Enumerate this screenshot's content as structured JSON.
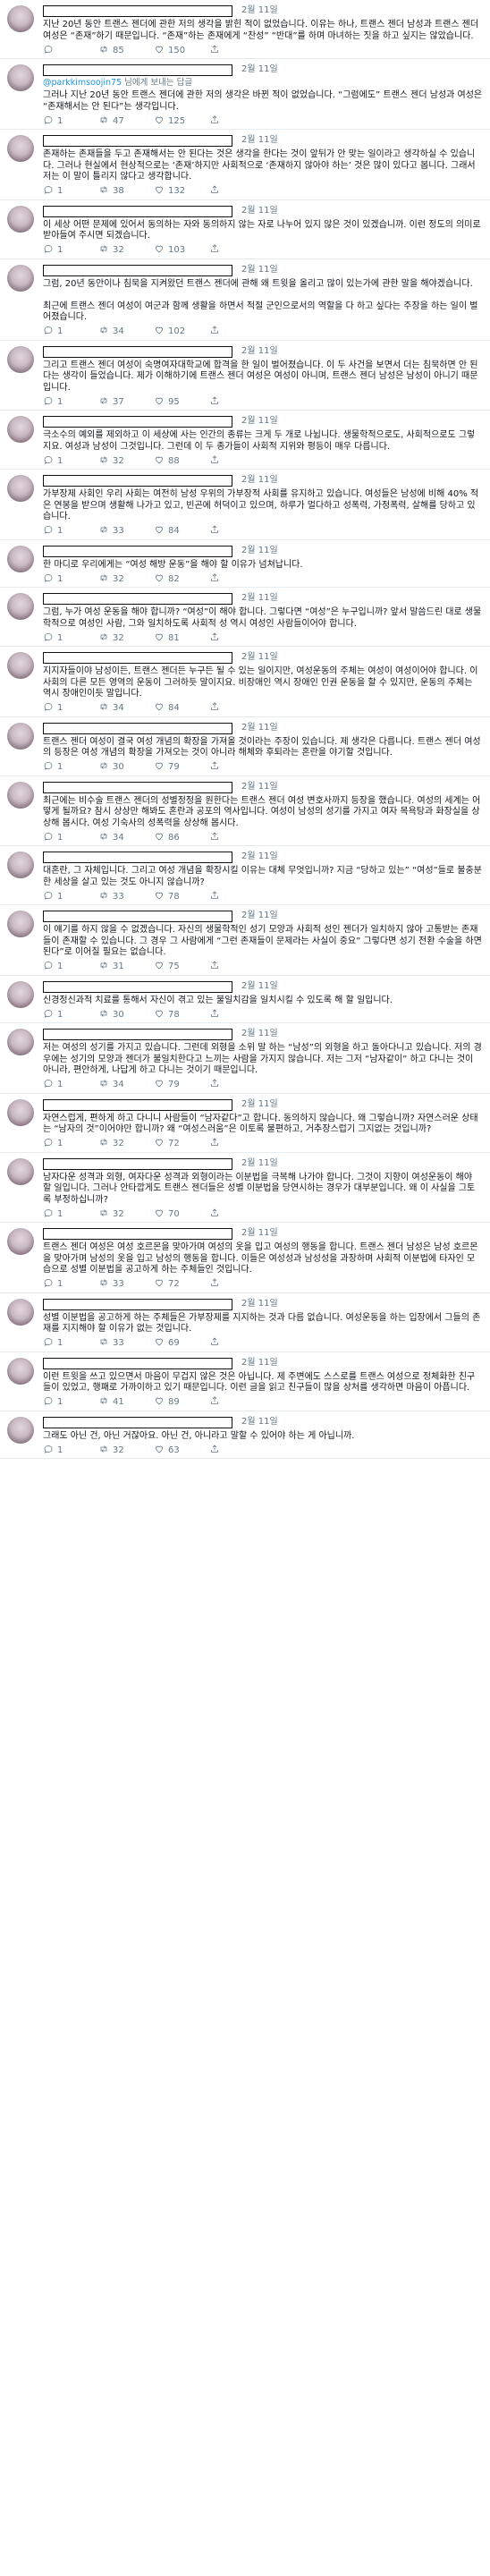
{
  "tweets": [
    {
      "date": "2월 11일",
      "body": "지난 20년 동안 트랜스 젠더에 관한 저의 생각을 밝힌 적이 없었습니다. 이유는 하나, 트랜스 젠더 남성과 트랜스 젠더 여성은 “존재”하기 때문입니다. “존재”하는 존재에게 “찬성” “반대”를 하며 마녀하는 짓을 하고 싶지는 않았습니다.",
      "counts": {
        "reply": "",
        "retweet": "85",
        "like": "150"
      }
    },
    {
      "date": "2월 11일",
      "reply_label": "님에게 보내는 답글",
      "reply_handle": "@parkkimsoojin75",
      "body": "그러나 지난 20년 동안 트랜스 젠더에 관한 저의 생각은 바뀐 적이 없었습니다. “그럼에도” 트랜스 젠더 남성과 여성은 “존재해서는 안 된다”는 생각입니다.",
      "counts": {
        "reply": "1",
        "retweet": "47",
        "like": "125"
      }
    },
    {
      "date": "2월 11일",
      "body": "존재하는 존재들을 두고 존재해서는 안 된다는 것은 생각을 한다는 것이 앞뒤가 안 맞는 일이라고 생각하실 수 있습니다. 그러나 현실에서 현상적으로는 ‘존재’하지만 사회적으로 ‘존재하지 않아야 하는’ 것은 많이 있다고 봅니다. 그래서 저는 이 말이 틀리지 않다고 생각합니다.",
      "counts": {
        "reply": "1",
        "retweet": "38",
        "like": "132"
      }
    },
    {
      "date": "2월 11일",
      "body": "이 세상 어떤 문제에 있어서 동의하는 자와 동의하지 않는 자로 나누어 있지 않은 것이 있겠습니까. 이런 정도의 의미로 받아들여 주시면 되겠습니다.",
      "counts": {
        "reply": "1",
        "retweet": "32",
        "like": "103"
      }
    },
    {
      "date": "2월 11일",
      "body": "그럼, 20년 동안이나 침묵을 지켜왔던 트랜스 젠더에 관해 왜 트윗을 올리고 많이 있는가에 관한 말을 해야겠습니다.\n\n최근에 트랜스 젠더 여성이 여군과 함께 생활을 하면서 적절 군인으로서의 역할을 다 하고 싶다는 주장을 하는 일이 벌어졌습니다.",
      "counts": {
        "reply": "1",
        "retweet": "34",
        "like": "102"
      }
    },
    {
      "date": "2월 11일",
      "body": "그리고 트랜스 젠더 여성이 숙명여자대학교에 합격을 한 일이 벌어졌습니다. 이 두 사건을 보면서 더는 침묵하면 안 된다는 생각이 들었습니다. 제가 이해하기에 트랜스 젠더 여성은 여성이 아니며, 트랜스 젠더 남성은 남성이 아니기 때문입니다.",
      "counts": {
        "reply": "1",
        "retweet": "37",
        "like": "95"
      }
    },
    {
      "date": "2월 11일",
      "body": "극소수의 예외를 제외하고 이 세상에 사는 인간의 종류는 크게 두 개로 나뉩니다. 생물학적으로도, 사회적으로도 그렇지요. 여성과 남성이 그것입니다. 그런데 이 두 종가들이 사회적 지위와 평등이 매우 다릅니다.",
      "counts": {
        "reply": "1",
        "retweet": "32",
        "like": "88"
      }
    },
    {
      "date": "2월 11일",
      "body": "가부장제 사회인 우리 사회는 여전히 남성 우위의 가부장적 사회를 유지하고 있습니다. 여성들은 남성에 비해 40% 적은 연봉을 받으며 생활해 나가고 있고, 빈곤에 허덕이고 있으며, 하루가 멀다하고 성폭력, 가정폭력, 살해를 당하고 있습니다.",
      "counts": {
        "reply": "1",
        "retweet": "33",
        "like": "84"
      }
    },
    {
      "date": "2월 11일",
      "body": "한 마디로 우리에게는 “여성 해방 운동”을 해야 할 이유가 넘쳐납니다.",
      "counts": {
        "reply": "1",
        "retweet": "32",
        "like": "82"
      }
    },
    {
      "date": "2월 11일",
      "body": "그럼, 누가 여성 운동을 해야 합니까? “여성”이 해야 합니다. 그렇다면 “여성”은 누구입니까? 앞서 말씀드린 대로 생물학적으로 여성인 사람, 그와 일치하도록 사회적 성 역시 여성인 사람들이어야 합니다.",
      "counts": {
        "reply": "1",
        "retweet": "32",
        "like": "81"
      }
    },
    {
      "date": "2월 11일",
      "body": "지지자들이야 남성이든, 트랜스 젠더든 누구든 될 수 있는 일이지만, 여성운동의 주체는 여성이 여성이어야 합니다. 이 사회의 다른 모든 영역의 운동이 그러하듯 말이지요. 비장애인 역시 장애인 인권 운동을 할 수 있지만, 운동의 주체는 역시 장애인이듯 말입니다.",
      "counts": {
        "reply": "1",
        "retweet": "34",
        "like": "84"
      }
    },
    {
      "date": "2월 11일",
      "body": "트랜스 젠더 여성이 결국 여성 개념의 확장을 가져올 것이라는 주장이 있습니다. 제 생각은 다릅니다. 트랜스 젠더 여성의 등장은 여성 개념의 확장을 가져오는 것이 아니라 해체와 후퇴라는 혼란을 야기할 것입니다.",
      "counts": {
        "reply": "1",
        "retweet": "30",
        "like": "79"
      }
    },
    {
      "date": "2월 11일",
      "body": "최근에는 비수술 트랜스 젠더의 성별정정을 원한다는 트랜스 젠더 여성 변호사까지 등장을 했습니다. 여성의 세계는 어떻게 될까요? 참시 상상만 해봐도 혼란과 공포의 역사입니다. 여성이 남성의 성기를 가지고 여자 목욕탕과 화장실을 상상해 봅시다. 여성 기숙사의 성폭력을 상상해 봅시다.",
      "counts": {
        "reply": "1",
        "retweet": "34",
        "like": "86"
      }
    },
    {
      "date": "2월 11일",
      "body": "대혼란, 그 자체입니다. 그리고 여성 개념을 확장시킬 이유는 대체 무엇입니까? 지금 “당하고 있는” “여성”들로 불충분한 세상을 살고 있는 것도 아니지 않습니까?",
      "counts": {
        "reply": "1",
        "retweet": "33",
        "like": "78"
      }
    },
    {
      "date": "2월 11일",
      "body": "이 얘기를 하지 않을 수 없겠습니다. 자신의 생물학적인 성기 모양과 사회적 성인 젠더가 일치하지 않아 고통받는 존재들이 존재할 수 있습니다. 그 경우 그 사람에게 “그런 존재들이 문제라는 사실이 중요” 그렇다면 성기 전환 수술을 하면 된다”로 이어질 필요는 없습니다.",
      "counts": {
        "reply": "1",
        "retweet": "31",
        "like": "75"
      }
    },
    {
      "date": "2월 11일",
      "body": "신경정신과적 치료를 통해서 자신이 겪고 있는 불일치감을 일치시킬 수 있도록 해 할 일입니다.",
      "counts": {
        "reply": "1",
        "retweet": "30",
        "like": "78"
      }
    },
    {
      "date": "2월 11일",
      "body": "저는 여성의 성기를 가지고 있습니다. 그런데 외형을 소위 말 하는 “남성”의 외형을 하고 돌아다니고 있습니다. 저의 경우에는 성기의 모양과 젠더가 불일치한다고 느끼는 사람을 가지지 않습니다. 저는 그저 “남자같이” 하고 다니는 것이 아니라, 편안하게, 나답게 하고 다니는 것이기 때문입니다.",
      "counts": {
        "reply": "1",
        "retweet": "34",
        "like": "79"
      }
    },
    {
      "date": "2월 11일",
      "body": "자연스럽게, 편하게 하고 다니니 사람들이 “남자같다”고 합니다. 동의하지 않습니다. 왜 그렇습니까? 자연스러운 상태는 “남자의 것”이어야만 합니까? 왜 “여성스러움”은 이토록 불편하고, 거추장스럽기 그지없는 것입니까?",
      "counts": {
        "reply": "1",
        "retweet": "32",
        "like": "72"
      }
    },
    {
      "date": "2월 11일",
      "body": "남자다운 성격과 외형, 여자다운 성격과 외형이라는 이분법을 극복해 나가야 합니다. 그것이 지향이 여성운동이 해야 할 일입니다. 그러나 안타깝게도 트랜스 젠더들은 성별 이분법을 당연시하는 경우가 대부분입니다. 왜 이 사실을 그토록 부정하십니까?",
      "counts": {
        "reply": "1",
        "retweet": "32",
        "like": "70"
      }
    },
    {
      "date": "2월 11일",
      "body": "트랜스 젠더 여성은 여성 호르몬을 맞아가며 여성의 옷을 입고 여성의 행동을 합니다. 트랜스 젠더 남성은 남성 호르몬을 맞아가며 남성의 옷을 입고 남성의 행동을 합니다. 이들은 여성성과 남성성을 과장하며 사회적 이분법에 타자인 모습으로 성별 이분법을 공고하게 하는 주체들인 것입니다.",
      "counts": {
        "reply": "1",
        "retweet": "33",
        "like": "72"
      }
    },
    {
      "date": "2월 11일",
      "body": "성별 이분법을 공고하게 하는 주체들은 가부장제를 지지하는 것과 다름 없습니다. 여성운동을 하는 입장에서 그들의 존재를 지지해야 할 이유가 없는 것입니다.",
      "counts": {
        "reply": "1",
        "retweet": "33",
        "like": "69"
      }
    },
    {
      "date": "2월 11일",
      "body": "이런 트윗을 쓰고 있으면서 마음이 무겁지 않은 것은 아닙니다. 제 주변에도 스스로를 트랜스 여성으로 정체화한 친구들이 있었고, 행패로 가까이하고 있기 때문입니다. 이런 글을 읽고 친구들이 많을 상처를 생각하면 마음이 아픕니다.",
      "counts": {
        "reply": "1",
        "retweet": "41",
        "like": "89"
      }
    },
    {
      "date": "2월 11일",
      "body": "그래도 아닌 건, 아닌 거잖아요. 아닌 건, 아니라고 말할 수 있어야 하는 게 아닙니까.",
      "counts": {
        "reply": "1",
        "retweet": "32",
        "like": "63"
      }
    }
  ]
}
